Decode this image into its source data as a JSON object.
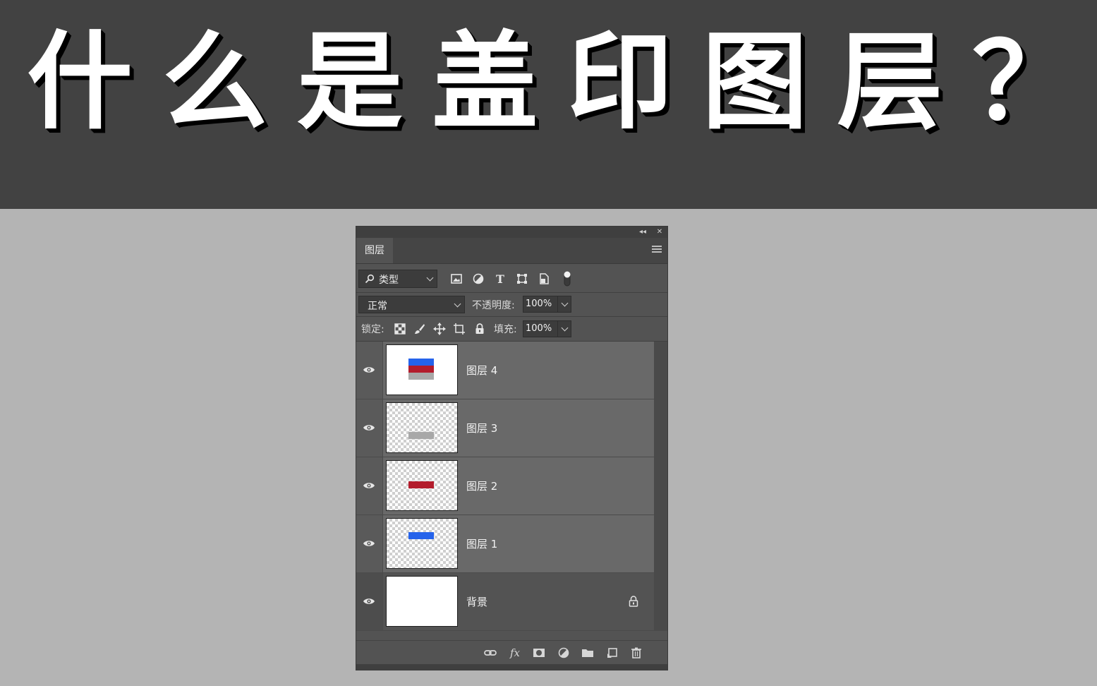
{
  "banner": {
    "title_chars": [
      "什",
      "么",
      "是",
      "盖",
      "印",
      "图",
      "层",
      "？"
    ]
  },
  "panel": {
    "collapse_label": "◂◂",
    "close_label": "✕",
    "tab": "图层",
    "filter": {
      "kind_label": "类型"
    },
    "blend_mode": "正常",
    "opacity_label": "不透明度:",
    "opacity_value": "100%",
    "lock_label": "锁定:",
    "fill_label": "填充:",
    "fill_value": "100%",
    "layers": [
      {
        "name": "图层 4",
        "thumb": "merged",
        "colors": [
          "#2563eb",
          "#b31c2c",
          "#a8a8a8"
        ]
      },
      {
        "name": "图层 3",
        "thumb": "gray-bar",
        "color": "#a8a8a8"
      },
      {
        "name": "图层 2",
        "thumb": "red-bar",
        "color": "#b31c2c"
      },
      {
        "name": "图层 1",
        "thumb": "blue-bar",
        "color": "#2563eb"
      },
      {
        "name": "背景",
        "thumb": "white",
        "locked": true
      }
    ],
    "footer_icons": [
      "link-icon",
      "fx-icon",
      "mask-icon",
      "adjustment-icon",
      "folder-icon",
      "new-layer-icon",
      "trash-icon"
    ],
    "fx_label": "fx"
  }
}
